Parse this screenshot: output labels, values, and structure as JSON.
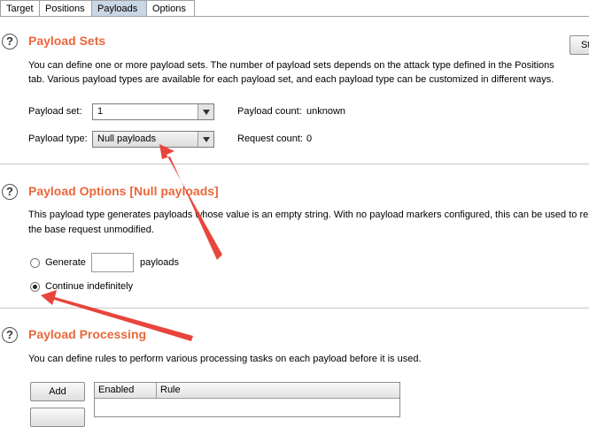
{
  "tabs": [
    {
      "label": "Target"
    },
    {
      "label": "Positions"
    },
    {
      "label": "Payloads",
      "active": true
    },
    {
      "label": "Options"
    }
  ],
  "payload_sets": {
    "title": "Payload Sets",
    "description_line1": "You can define one or more payload sets. The number of payload sets depends on the attack type defined in the Positions",
    "description_line2": "tab. Various payload types are available for each payload set, and each payload type can be customized in different ways.",
    "set_label": "Payload set:",
    "set_value": "1",
    "type_label": "Payload type:",
    "type_value": "Null payloads",
    "count_label": "Payload count:",
    "count_value": "unknown",
    "request_label": "Request count:",
    "request_value": "0",
    "side_button_label": "St"
  },
  "payload_options": {
    "title": "Payload Options [Null payloads]",
    "description_line1": "This payload type generates payloads whose value is an empty string. With no payload markers configured, this can be used to rep",
    "description_line2": "the base request unmodified.",
    "generate_label": "Generate",
    "generate_value": "",
    "payloads_label": "payloads",
    "continue_label": "Continue indefinitely",
    "selected_option": "continue"
  },
  "payload_processing": {
    "title": "Payload Processing",
    "description": "You can define rules to perform various processing tasks on each payload before it is used.",
    "add_button": "Add",
    "columns": [
      "Enabled",
      "Rule"
    ]
  },
  "colors": {
    "title": "#e8683c",
    "active_tab": "#c9d6e5",
    "annotation_arrow": "#e8453c"
  },
  "icons": {
    "help": "question-circle-icon",
    "dropdown": "triangle-down-icon"
  }
}
